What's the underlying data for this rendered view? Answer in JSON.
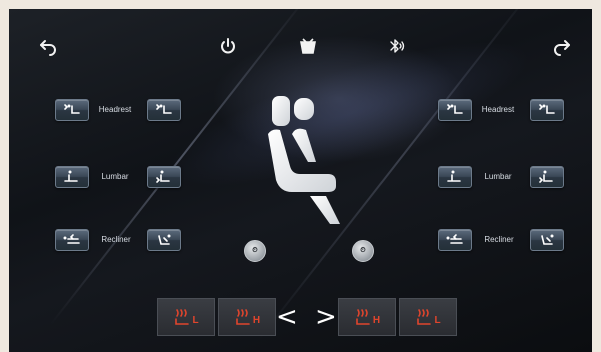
{
  "top_bar": {
    "icons": [
      "back-icon",
      "power-icon",
      "massage-icon",
      "bluetooth-icon",
      "forward-icon"
    ]
  },
  "left_controls": {
    "headrest_label": "Headrest",
    "lumbar_label": "Lumbar",
    "recliner_label": "Recliner"
  },
  "right_controls": {
    "headrest_label": "Headrest",
    "lumbar_label": "Lumbar",
    "recliner_label": "Recliner"
  },
  "timer": {
    "left_label": "⏲",
    "right_label": "⏲"
  },
  "bottom_bar": {
    "left_heat_low_sub": "L",
    "left_heat_high_sub": "H",
    "prev_arrow": "<",
    "next_arrow": ">",
    "right_heat_high_sub": "H",
    "right_heat_low_sub": "L",
    "heat_color": "#e0452d"
  },
  "colors": {
    "background": "#101318",
    "button": "#3a4756",
    "text": "#d8dde4"
  }
}
